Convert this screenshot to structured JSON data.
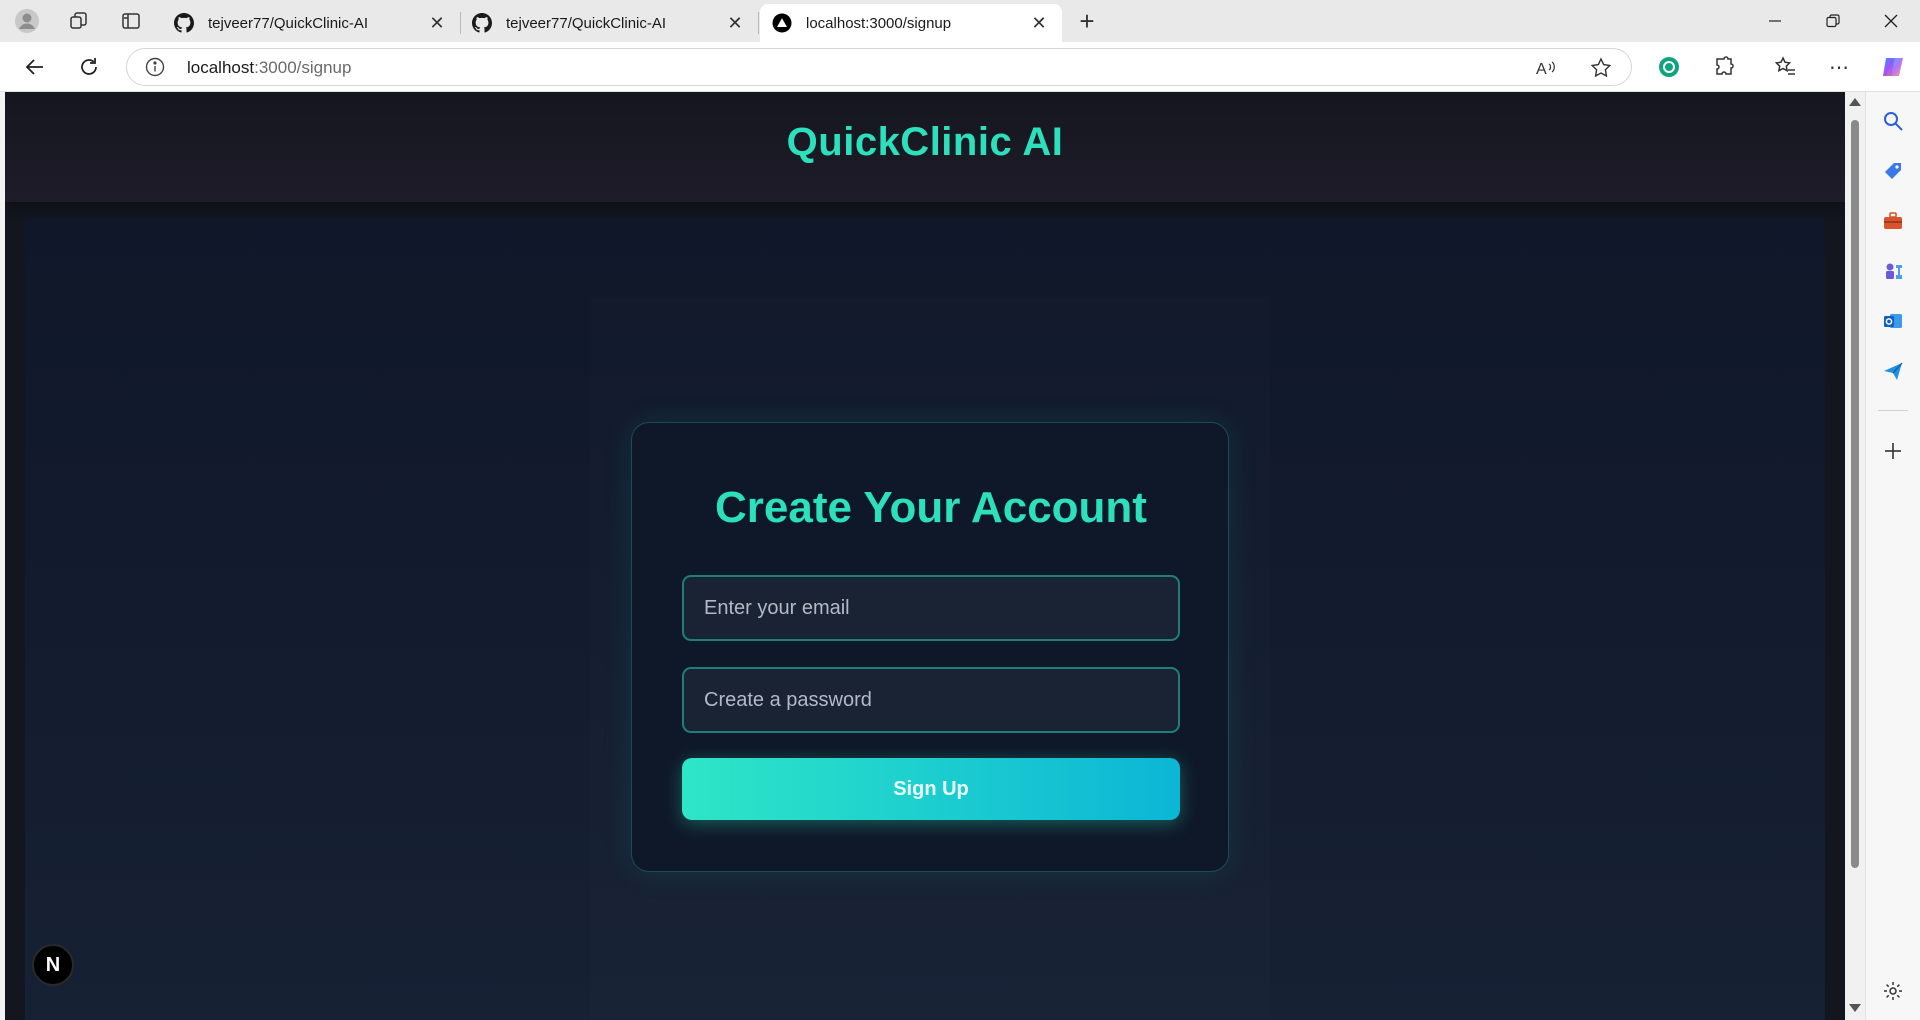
{
  "browser": {
    "tabs": [
      {
        "title": "tejveer77/QuickClinic-AI",
        "favicon": "github-icon",
        "active": false
      },
      {
        "title": "tejveer77/QuickClinic-AI",
        "favicon": "github-icon",
        "active": false
      },
      {
        "title": "localhost:3000/signup",
        "favicon": "nextjs-triangle-icon",
        "active": true
      }
    ],
    "new_tab_symbol": "+",
    "address": {
      "host": "localhost",
      "path": ":3000/signup"
    }
  },
  "page": {
    "brand": "QuickClinic AI",
    "form": {
      "title": "Create Your Account",
      "email_placeholder": "Enter your email",
      "password_placeholder": "Create a password",
      "submit_label": "Sign Up"
    },
    "dev_badge": "N"
  },
  "colors": {
    "accent": "#2de0bd",
    "button_gradient_start": "#2ee6c7",
    "button_gradient_end": "#0bb6d6",
    "page_bg": "#0f1729"
  }
}
